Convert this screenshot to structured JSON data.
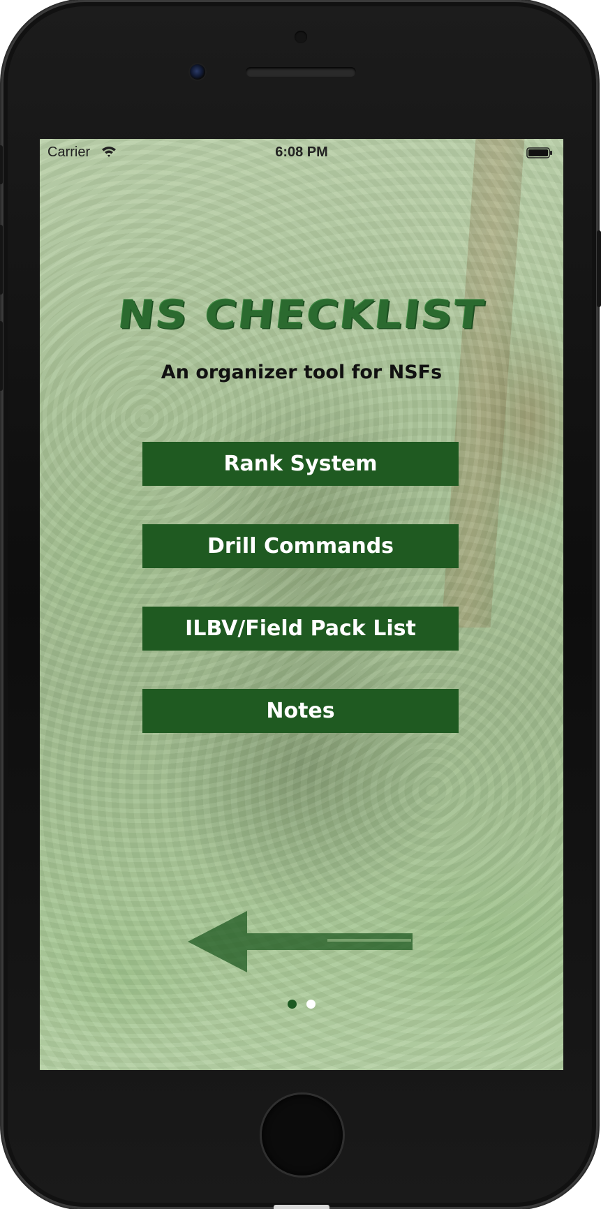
{
  "status_bar": {
    "carrier": "Carrier",
    "time": "6:08 PM"
  },
  "header": {
    "title": "NS CHECKLIST",
    "subtitle": "An organizer tool for NSFs"
  },
  "menu": {
    "items": [
      {
        "label": "Rank System"
      },
      {
        "label": "Drill Commands"
      },
      {
        "label": "ILBV/Field Pack List"
      },
      {
        "label": "Notes"
      }
    ]
  },
  "pager": {
    "page_count": 2,
    "current_page": 1
  },
  "icons": {
    "wifi": "wifi-icon",
    "battery": "battery-icon",
    "arrow": "arrow-left-icon"
  },
  "colors": {
    "accent_green": "#1f5a21",
    "title_green": "#2b6a2f",
    "button_text": "#ffffff"
  }
}
